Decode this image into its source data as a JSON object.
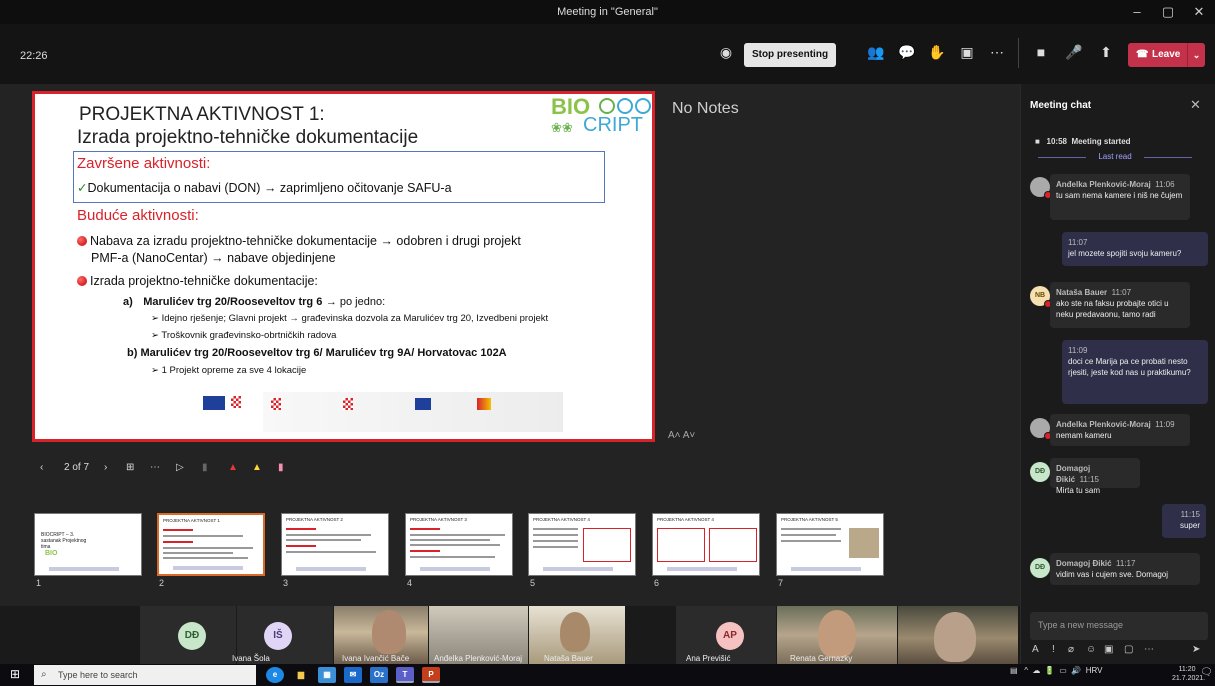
{
  "window": {
    "title": "Meeting in \"General\""
  },
  "toolbar": {
    "time": "22:26",
    "stop_presenting": "Stop presenting",
    "leave": "Leave"
  },
  "slide": {
    "title_line1": "PROJEKTNA AKTIVNOST 1:",
    "title_line2": "Izrada projektno-tehničke dokumentacije",
    "logo_top": "BIO",
    "logo_bottom": "CRIPT",
    "completed_heading": "Završene aktivnosti:",
    "completed_item": "Dokumentacija o nabavi (DON) → zaprimljeno očitovanje SAFU-a",
    "future_heading": "Buduće aktivnosti:",
    "future_1a": "Nabava za izradu projektno-tehničke dokumentacije → odobren i drugi projekt",
    "future_1b": "PMF-a (NanoCentar) → nabave objedinjene",
    "future_2": "Izrada projektno-tehničke dokumentacije:",
    "a_label": "a)",
    "a_text": "Marulićev trg 20/Rooseveltov trg 6",
    "a_suffix": "→ po jedno:",
    "a_sub1": "➢ Idejno rješenje; Glavni projekt → građevinska dozvola za Marulićev trg 20, Izvedbeni projekt",
    "a_sub2": "➢ Troškovnik građevinsko-obrtničkih radova",
    "b_text": "b) Marulićev trg 20/Rooseveltov trg 6/ Marulićev trg 9A/ Horvatovac 102A",
    "b_sub1": "➢ 1 Projekt opreme za sve 4 lokacije"
  },
  "notes": {
    "text": "No Notes",
    "font_controls": "A˄  A˅"
  },
  "slide_nav": {
    "counter": "2 of 7"
  },
  "thumbnails": [
    {
      "num": "1",
      "title": "BIOCRIPT – 3. sastanak Projektnog tima"
    },
    {
      "num": "2",
      "title": "PROJEKTNA AKTIVNOST 1"
    },
    {
      "num": "3",
      "title": "PROJEKTNA AKTIVNOST 2"
    },
    {
      "num": "4",
      "title": "PROJEKTNA AKTIVNOST 3"
    },
    {
      "num": "5",
      "title": "PROJEKTNA AKTIVNOST 4"
    },
    {
      "num": "6",
      "title": "PROJEKTNA AKTIVNOST 4"
    },
    {
      "num": "7",
      "title": "PROJEKTNA AKTIVNOST 5"
    }
  ],
  "participants": [
    {
      "initials": "DĐ",
      "name": ""
    },
    {
      "initials": "IŠ",
      "name": "Ivana Šola"
    },
    {
      "initials": "",
      "name": "Ivana Ivančić Bače"
    },
    {
      "initials": "",
      "name": "Anđelka Plenković-Moraj"
    },
    {
      "initials": "",
      "name": "Nataša Bauer"
    },
    {
      "initials": "AP",
      "name": "Ana Previšić"
    },
    {
      "initials": "",
      "name": "Renata Gernazky"
    }
  ],
  "chat": {
    "title": "Meeting chat",
    "meeting_started_time": "10:58",
    "meeting_started": "Meeting started",
    "last_read": "Last read",
    "messages": [
      {
        "author": "Anđelka Plenković-Moraj",
        "time": "11:06",
        "text": "tu sam nema kamere i niš ne čujem"
      },
      {
        "author": "",
        "time": "11:07",
        "text": "jel mozete spojiti svoju kameru?"
      },
      {
        "author": "Nataša Bauer",
        "time": "11:07",
        "initials": "NB",
        "text": "ako ste na faksu probajte otici u neku predavaonu, tamo radi"
      },
      {
        "author": "",
        "time": "11:09",
        "text": "doci ce Marija pa ce probati nesto rjesiti, jeste kod nas u praktikumu?"
      },
      {
        "author": "Anđelka Plenković-Moraj",
        "time": "11:09",
        "text": "nemam kameru"
      },
      {
        "author": "Domagoj Đikić",
        "time": "11:15",
        "initials": "DĐ",
        "text": "Mirta tu sam"
      },
      {
        "author": "",
        "time": "11:15",
        "text": "super"
      },
      {
        "author": "Domagoj Đikić",
        "time": "11:17",
        "initials": "DĐ",
        "text": "vidim vas i cujem sve. Domagoj"
      }
    ],
    "input_placeholder": "Type a new message"
  },
  "taskbar": {
    "search_placeholder": "Type here to search",
    "lang": "HRV",
    "time": "11:20",
    "date": "21.7.2021."
  },
  "colors": {
    "accent": "#6264a7",
    "leave": "#c4314b",
    "slide_red": "#d8232a"
  }
}
